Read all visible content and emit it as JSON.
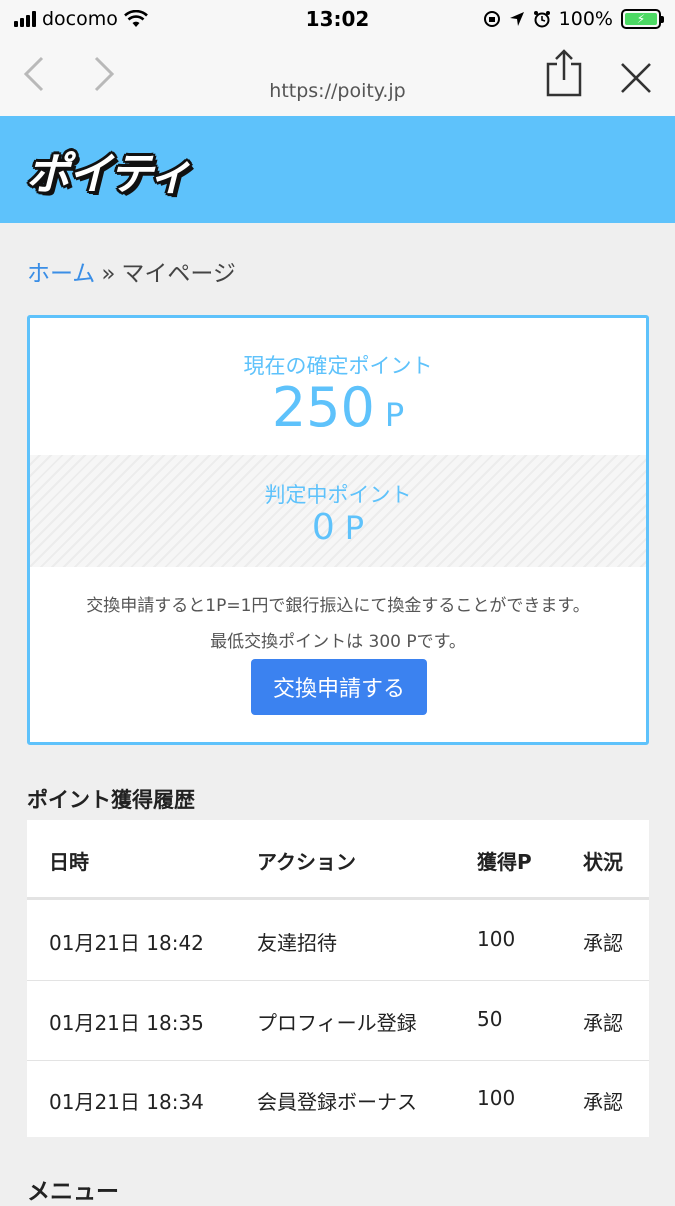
{
  "status_bar": {
    "carrier": "docomo",
    "time": "13:02",
    "battery": "100%"
  },
  "browser": {
    "url": "https://poity.jp",
    "back_icon": "chevron-left-icon",
    "forward_icon": "chevron-right-icon",
    "share_icon": "share-icon",
    "close_icon": "close-icon"
  },
  "site": {
    "logo": "ポイティ",
    "header_color": "#5ec2fb"
  },
  "breadcrumb": {
    "home": "ホーム",
    "separator": "»",
    "current": "マイページ"
  },
  "points": {
    "confirmed_label": "現在の確定ポイント",
    "confirmed_value": "250",
    "confirmed_unit": "P",
    "pending_label": "判定中ポイント",
    "pending_value": "0",
    "pending_unit": "P",
    "note_1": "交換申請すると1P=1円で銀行振込にて換金することができます。",
    "note_2": "最低交換ポイントは 300 Pです。",
    "exchange_button": "交換申請する"
  },
  "history": {
    "title": "ポイント獲得履歴",
    "headers": [
      "日時",
      "アクション",
      "獲得P",
      "状況"
    ],
    "rows": [
      {
        "date": "01月21日 18:42",
        "action": "友達招待",
        "points": "100",
        "status": "承認"
      },
      {
        "date": "01月21日 18:35",
        "action": "プロフィール登録",
        "points": "50",
        "status": "承認"
      },
      {
        "date": "01月21日 18:34",
        "action": "会員登録ボーナス",
        "points": "100",
        "status": "承認"
      }
    ]
  },
  "menu": {
    "title": "メニュー"
  }
}
